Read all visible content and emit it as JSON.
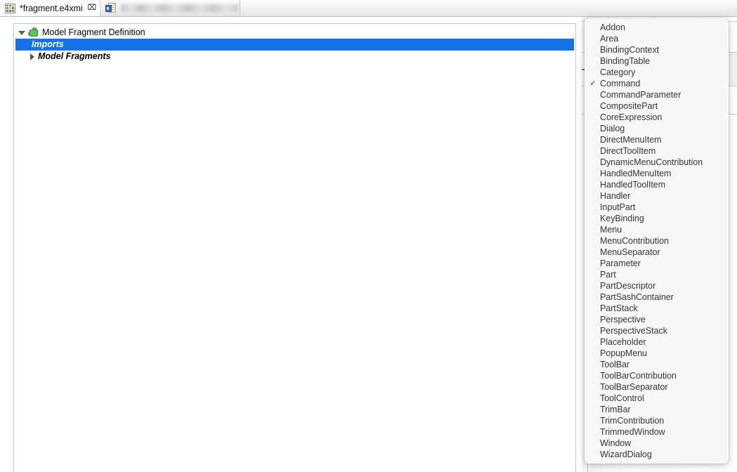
{
  "tabs": [
    {
      "label": "*fragment.e4xmi",
      "icon": "model-editor-grid-icon",
      "close_glyph": "⌧",
      "active": true
    },
    {
      "label": "",
      "icon": "java-class-icon",
      "active": false,
      "redacted": true
    }
  ],
  "tree": {
    "root": {
      "label": "Model Fragment Definition",
      "icon": "green-puzzle-icon",
      "expanded": true
    },
    "children": [
      {
        "label": "Imports",
        "selected": true,
        "italic": true
      },
      {
        "label": "Model Fragments",
        "selected": false,
        "italic": true,
        "expanded": false
      }
    ]
  },
  "dropdown": {
    "selected": "Command",
    "check_glyph": "✓",
    "items": [
      "Addon",
      "Area",
      "BindingContext",
      "BindingTable",
      "Category",
      "Command",
      "CommandParameter",
      "CompositePart",
      "CoreExpression",
      "Dialog",
      "DirectMenuItem",
      "DirectToolItem",
      "DynamicMenuContribution",
      "HandledMenuItem",
      "HandledToolItem",
      "Handler",
      "InputPart",
      "KeyBinding",
      "Menu",
      "MenuContribution",
      "MenuSeparator",
      "Parameter",
      "Part",
      "PartDescriptor",
      "PartSashContainer",
      "PartStack",
      "Perspective",
      "PerspectiveStack",
      "Placeholder",
      "PopupMenu",
      "ToolBar",
      "ToolBarContribution",
      "ToolBarSeparator",
      "ToolControl",
      "TrimBar",
      "TrimContribution",
      "TrimmedWindow",
      "Window",
      "WizardDialog"
    ]
  },
  "right_panel": {
    "action_button_glyph": "⟳"
  },
  "colors": {
    "selection_blue": "#1473e6",
    "menu_background": "#f7f7f7",
    "menu_text": "#353535",
    "button_blue": "#1a6fd8",
    "puzzle_green": "#5dc45d"
  }
}
